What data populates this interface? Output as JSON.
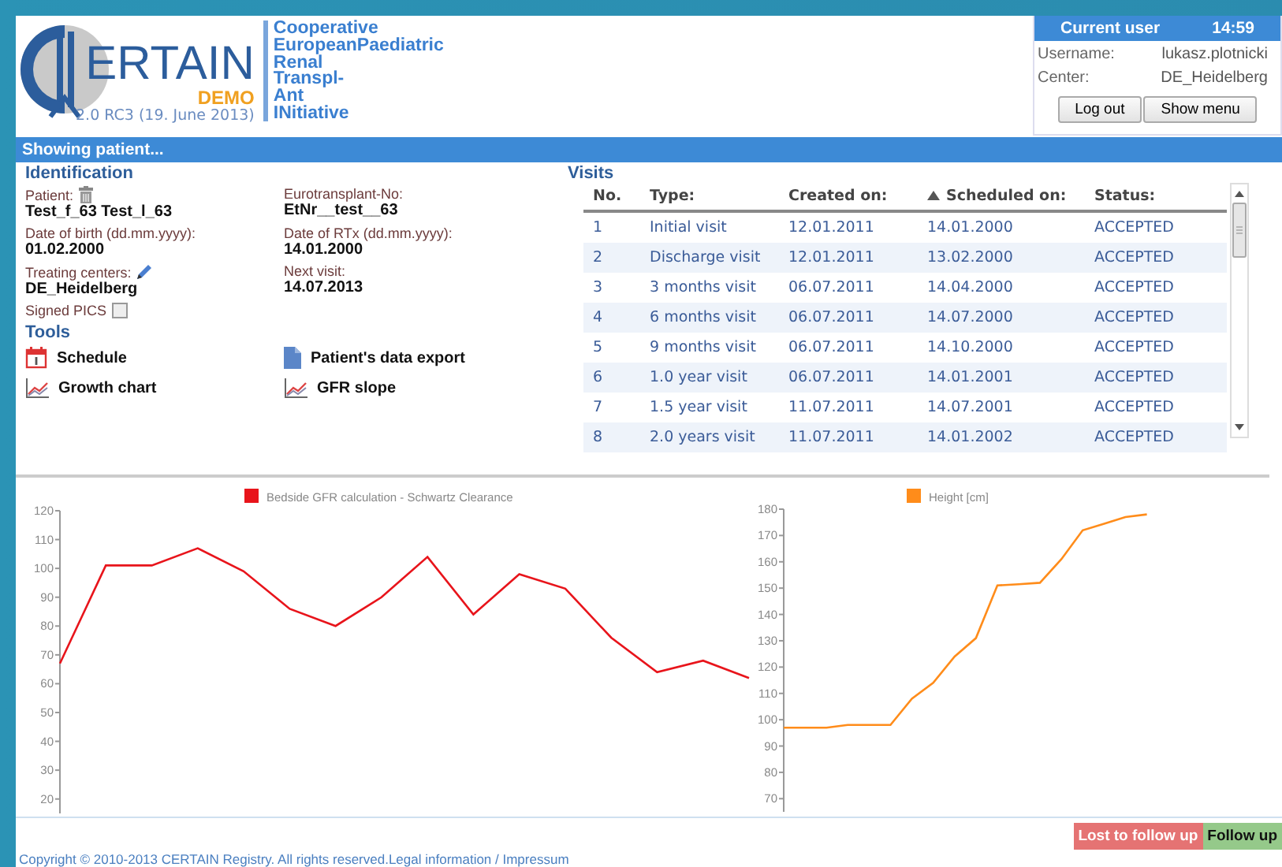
{
  "header": {
    "logo": {
      "wordmark": "ERTAIN",
      "badge": "DEMO",
      "version": "2.0 RC3 (19. June 2013)"
    },
    "acronym_lines": [
      "Cooperative",
      "EuropeanPaediatric",
      "Renal",
      "Transpl-",
      "Ant",
      "INitiative"
    ],
    "user_panel": {
      "title": "Current user",
      "time": "14:59",
      "fields": [
        {
          "label": "Username:",
          "value": "lukasz.plotnicki"
        },
        {
          "label": "Center:",
          "value": "DE_Heidelberg"
        }
      ],
      "buttons": [
        "Log out",
        "Show menu"
      ]
    }
  },
  "patient_bar": {
    "title": "Showing patient..."
  },
  "identification": {
    "heading": "Identification",
    "fields": [
      {
        "label": "Patient:",
        "value": "Test_f_63 Test_l_63",
        "kind": "deletable"
      },
      {
        "label": "Eurotransplant-No:",
        "value": "EtNr__test__63",
        "kind": "plain"
      },
      {
        "label": "Date of birth (dd.mm.yyyy):",
        "value": "01.02.2000",
        "kind": "plain"
      },
      {
        "label": "Date of RTx (dd.mm.yyyy):",
        "value": "14.01.2000",
        "kind": "plain"
      },
      {
        "label": "Treating centers:",
        "value": "DE_Heidelberg",
        "kind": "editable"
      },
      {
        "label": "Next visit:",
        "value": "14.07.2013",
        "kind": "plain"
      }
    ],
    "signed_pics": {
      "label": "Signed PICS",
      "checked": false
    }
  },
  "tools": {
    "heading": "Tools",
    "items": [
      {
        "label": "Schedule",
        "kind": "calendar"
      },
      {
        "label": "Patient's data export",
        "kind": "document"
      },
      {
        "label": "Growth chart",
        "kind": "chart"
      },
      {
        "label": "GFR slope",
        "kind": "chart"
      }
    ]
  },
  "visits": {
    "heading": "Visits",
    "columns": [
      {
        "label": "No.",
        "sorted": false
      },
      {
        "label": "Type:",
        "sorted": false
      },
      {
        "label": "Created on:",
        "sorted": false
      },
      {
        "label": "Scheduled on:",
        "sorted": true
      },
      {
        "label": "Status:",
        "sorted": false
      }
    ],
    "rows": [
      [
        "1",
        "Initial visit",
        "12.01.2011",
        "14.01.2000",
        "ACCEPTED"
      ],
      [
        "2",
        "Discharge visit",
        "12.01.2011",
        "13.02.2000",
        "ACCEPTED"
      ],
      [
        "3",
        "3 months visit",
        "06.07.2011",
        "14.04.2000",
        "ACCEPTED"
      ],
      [
        "4",
        "6 months visit",
        "06.07.2011",
        "14.07.2000",
        "ACCEPTED"
      ],
      [
        "5",
        "9 months visit",
        "06.07.2011",
        "14.10.2000",
        "ACCEPTED"
      ],
      [
        "6",
        "1.0 year visit",
        "06.07.2011",
        "14.01.2001",
        "ACCEPTED"
      ],
      [
        "7",
        "1.5 year visit",
        "11.07.2011",
        "14.07.2001",
        "ACCEPTED"
      ],
      [
        "8",
        "2.0 years visit",
        "11.07.2011",
        "14.01.2002",
        "ACCEPTED"
      ]
    ]
  },
  "charts": [
    {
      "chart_data": {
        "type": "line",
        "categories": [
          null,
          null,
          null,
          null,
          null,
          null,
          null,
          null,
          null,
          null,
          null,
          null,
          null,
          null,
          null,
          null
        ],
        "ylim": [
          15,
          120
        ],
        "yticks": [
          20,
          30,
          40,
          50,
          60,
          70,
          80,
          90,
          100,
          110,
          120
        ],
        "series": [
          {
            "name": "Bedside GFR calculation - Schwartz Clearance",
            "color": "#e8141b",
            "values": [
              67,
              101,
              101,
              107,
              99,
              86,
              80,
              90,
              104,
              84,
              98,
              93,
              76,
              64,
              68,
              62
            ]
          }
        ]
      }
    },
    {
      "chart_data": {
        "type": "line",
        "categories": [
          null,
          null,
          null,
          null,
          null,
          null,
          null,
          null,
          null,
          null,
          null,
          null,
          null,
          null,
          null,
          null,
          null,
          null
        ],
        "ylim": [
          65,
          180
        ],
        "yticks": [
          70,
          80,
          90,
          100,
          110,
          120,
          130,
          140,
          150,
          160,
          170,
          180
        ],
        "series": [
          {
            "name": "Height [cm]",
            "color": "#ff8c1a",
            "values": [
              97,
              97,
              97,
              98,
              98,
              98,
              108,
              114,
              124,
              131,
              151,
              151.5,
              152,
              161,
              172,
              174.5,
              177,
              178
            ]
          }
        ]
      }
    }
  ],
  "footer": {
    "copyright": "Copyright © 2010-2013 CERTAIN Registry. All rights reserved.",
    "link": "Legal information / Impressum",
    "buttons": [
      {
        "label": "Lost to follow up",
        "kind": "danger"
      },
      {
        "label": "Follow up",
        "kind": "success"
      }
    ]
  }
}
